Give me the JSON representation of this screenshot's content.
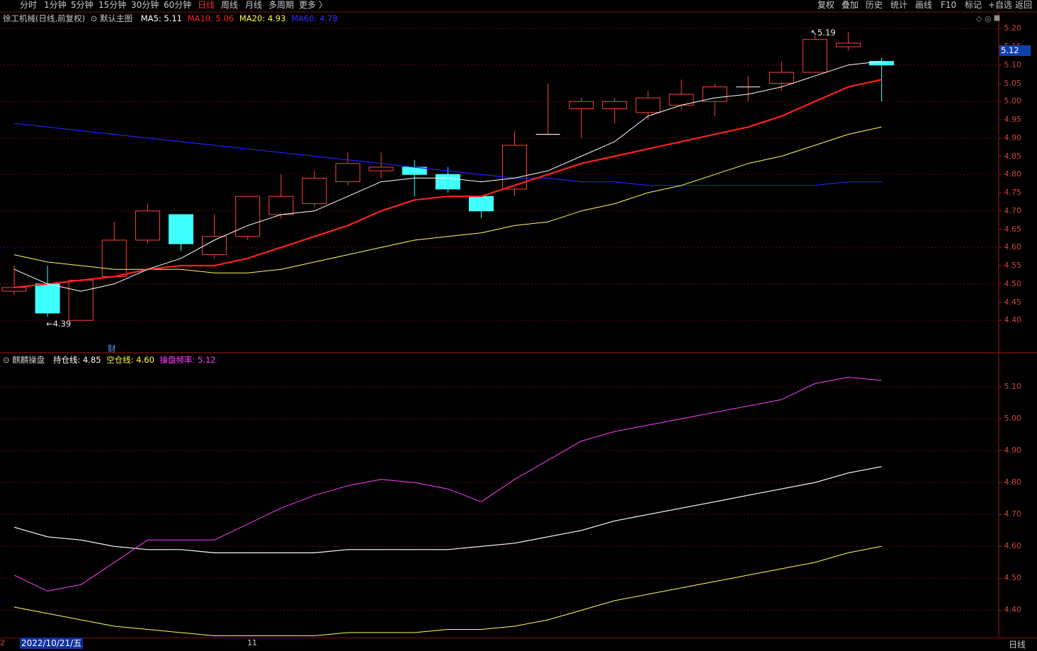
{
  "toolbar": {
    "tabs": [
      "分时",
      "1分钟",
      "5分钟",
      "15分钟",
      "30分钟",
      "60分钟",
      "日线",
      "周线",
      "月线",
      "多周期",
      "更多 〉"
    ],
    "active_tab": "日线",
    "right_buttons": [
      "复权",
      "叠加",
      "历史",
      "统计",
      "画线",
      "F10",
      "标记",
      "+自选",
      "返回"
    ]
  },
  "main_chart": {
    "legend": {
      "title": "徐工机械(日线,前复权)",
      "template": "默认主图",
      "ma5_label": "MA5: 5.11",
      "ma10_label": "MA10: 5.06",
      "ma20_label": "MA20: 4.93",
      "ma60_label": "MA60: 4.78"
    },
    "axis_ticks": [
      "5.20",
      "5.15",
      "5.10",
      "5.05",
      "5.00",
      "4.95",
      "4.90",
      "4.85",
      "4.80",
      "4.75",
      "4.70",
      "4.65",
      "4.60",
      "4.55",
      "4.50",
      "4.45",
      "4.40"
    ],
    "current_price": "5.12",
    "high_label": "5.19",
    "low_label": "4.39",
    "event_marker": "财",
    "ylim": [
      4.35,
      5.22
    ],
    "colors": {
      "up": "#ff4040",
      "down": "#40ffff",
      "ma5": "#ffffff",
      "ma10": "#ff2020",
      "ma20": "#ffff60",
      "ma60": "#2020ff"
    },
    "candles": [
      {
        "o": 4.48,
        "c": 4.49,
        "h": 4.55,
        "l": 4.47
      },
      {
        "o": 4.5,
        "c": 4.42,
        "h": 4.55,
        "l": 4.41
      },
      {
        "o": 4.4,
        "c": 4.51,
        "h": 4.51,
        "l": 4.4
      },
      {
        "o": 4.52,
        "c": 4.62,
        "h": 4.67,
        "l": 4.52
      },
      {
        "o": 4.62,
        "c": 4.7,
        "h": 4.72,
        "l": 4.61
      },
      {
        "o": 4.69,
        "c": 4.61,
        "h": 4.69,
        "l": 4.59
      },
      {
        "o": 4.58,
        "c": 4.63,
        "h": 4.69,
        "l": 4.57
      },
      {
        "o": 4.63,
        "c": 4.74,
        "h": 4.74,
        "l": 4.62
      },
      {
        "o": 4.69,
        "c": 4.74,
        "h": 4.8,
        "l": 4.68
      },
      {
        "o": 4.72,
        "c": 4.79,
        "h": 4.81,
        "l": 4.71
      },
      {
        "o": 4.78,
        "c": 4.83,
        "h": 4.86,
        "l": 4.77
      },
      {
        "o": 4.81,
        "c": 4.82,
        "h": 4.86,
        "l": 4.79
      },
      {
        "o": 4.82,
        "c": 4.8,
        "h": 4.84,
        "l": 4.74
      },
      {
        "o": 4.8,
        "c": 4.76,
        "h": 4.82,
        "l": 4.75
      },
      {
        "o": 4.74,
        "c": 4.7,
        "h": 4.74,
        "l": 4.68
      },
      {
        "o": 4.76,
        "c": 4.88,
        "h": 4.92,
        "l": 4.74
      },
      {
        "o": 4.91,
        "c": 4.91,
        "h": 5.05,
        "l": 4.91
      },
      {
        "o": 4.98,
        "c": 5.0,
        "h": 5.01,
        "l": 4.9
      },
      {
        "o": 4.98,
        "c": 5.0,
        "h": 5.01,
        "l": 4.94
      },
      {
        "o": 4.97,
        "c": 5.01,
        "h": 5.03,
        "l": 4.95
      },
      {
        "o": 4.99,
        "c": 5.02,
        "h": 5.06,
        "l": 4.98
      },
      {
        "o": 5.0,
        "c": 5.04,
        "h": 5.05,
        "l": 4.96
      },
      {
        "o": 5.04,
        "c": 5.04,
        "h": 5.07,
        "l": 5.0
      },
      {
        "o": 5.05,
        "c": 5.08,
        "h": 5.11,
        "l": 5.03
      },
      {
        "o": 5.08,
        "c": 5.17,
        "h": 5.18,
        "l": 5.08
      },
      {
        "o": 5.15,
        "c": 5.16,
        "h": 5.19,
        "l": 5.14
      },
      {
        "o": 5.11,
        "c": 5.1,
        "h": 5.12,
        "l": 5.0
      }
    ],
    "ma5": [
      4.54,
      4.5,
      4.48,
      4.5,
      4.54,
      4.57,
      4.62,
      4.66,
      4.69,
      4.7,
      4.74,
      4.78,
      4.79,
      4.79,
      4.78,
      4.79,
      4.81,
      4.85,
      4.89,
      4.96,
      4.99,
      5.01,
      5.02,
      5.04,
      5.07,
      5.1,
      5.11
    ],
    "ma10": [
      4.49,
      4.5,
      4.51,
      4.52,
      4.54,
      4.55,
      4.55,
      4.57,
      4.6,
      4.63,
      4.66,
      4.7,
      4.73,
      4.74,
      4.74,
      4.77,
      4.8,
      4.83,
      4.85,
      4.87,
      4.89,
      4.91,
      4.93,
      4.96,
      5.0,
      5.04,
      5.06
    ],
    "ma20": [
      4.58,
      4.56,
      4.55,
      4.54,
      4.54,
      4.54,
      4.53,
      4.53,
      4.54,
      4.56,
      4.58,
      4.6,
      4.62,
      4.63,
      4.64,
      4.66,
      4.67,
      4.7,
      4.72,
      4.75,
      4.77,
      4.8,
      4.83,
      4.85,
      4.88,
      4.91,
      4.93
    ],
    "ma60": [
      4.94,
      4.93,
      4.92,
      4.91,
      4.9,
      4.89,
      4.88,
      4.87,
      4.86,
      4.85,
      4.84,
      4.83,
      4.82,
      4.81,
      4.8,
      4.79,
      4.79,
      4.78,
      4.78,
      4.77,
      4.77,
      4.77,
      4.77,
      4.77,
      4.77,
      4.78,
      4.78
    ]
  },
  "indicator": {
    "legend": {
      "title": "麒麟操盘",
      "hold_label": "持仓线: 4.85",
      "empty_label": "空仓线: 4.60",
      "freq_label": "操盘频率: 5.12"
    },
    "axis_ticks": [
      "5.10",
      "5.00",
      "4.90",
      "4.80",
      "4.70",
      "4.60",
      "4.50",
      "4.40"
    ],
    "ylim": [
      4.33,
      5.18
    ],
    "colors": {
      "hold": "#ffffff",
      "empty": "#ffff60",
      "freq": "#ff40ff"
    },
    "hold": [
      4.66,
      4.63,
      4.62,
      4.6,
      4.59,
      4.59,
      4.58,
      4.58,
      4.58,
      4.58,
      4.59,
      4.59,
      4.59,
      4.59,
      4.6,
      4.61,
      4.63,
      4.65,
      4.68,
      4.7,
      4.72,
      4.74,
      4.76,
      4.78,
      4.8,
      4.83,
      4.85
    ],
    "empty": [
      4.41,
      4.39,
      4.37,
      4.35,
      4.34,
      4.33,
      4.32,
      4.32,
      4.32,
      4.32,
      4.33,
      4.33,
      4.33,
      4.34,
      4.34,
      4.35,
      4.37,
      4.4,
      4.43,
      4.45,
      4.47,
      4.49,
      4.51,
      4.53,
      4.55,
      4.58,
      4.6
    ],
    "freq": [
      4.51,
      4.46,
      4.48,
      4.55,
      4.62,
      4.62,
      4.62,
      4.67,
      4.72,
      4.76,
      4.79,
      4.81,
      4.8,
      4.78,
      4.74,
      4.81,
      4.87,
      4.93,
      4.96,
      4.98,
      5.0,
      5.02,
      5.04,
      5.06,
      5.11,
      5.13,
      5.12
    ]
  },
  "footer": {
    "date": "2022/10/21/五",
    "tick_11": "11",
    "tick_left": "2",
    "period": "日线"
  },
  "corner_icons": "◇ ◎ ⯀"
}
